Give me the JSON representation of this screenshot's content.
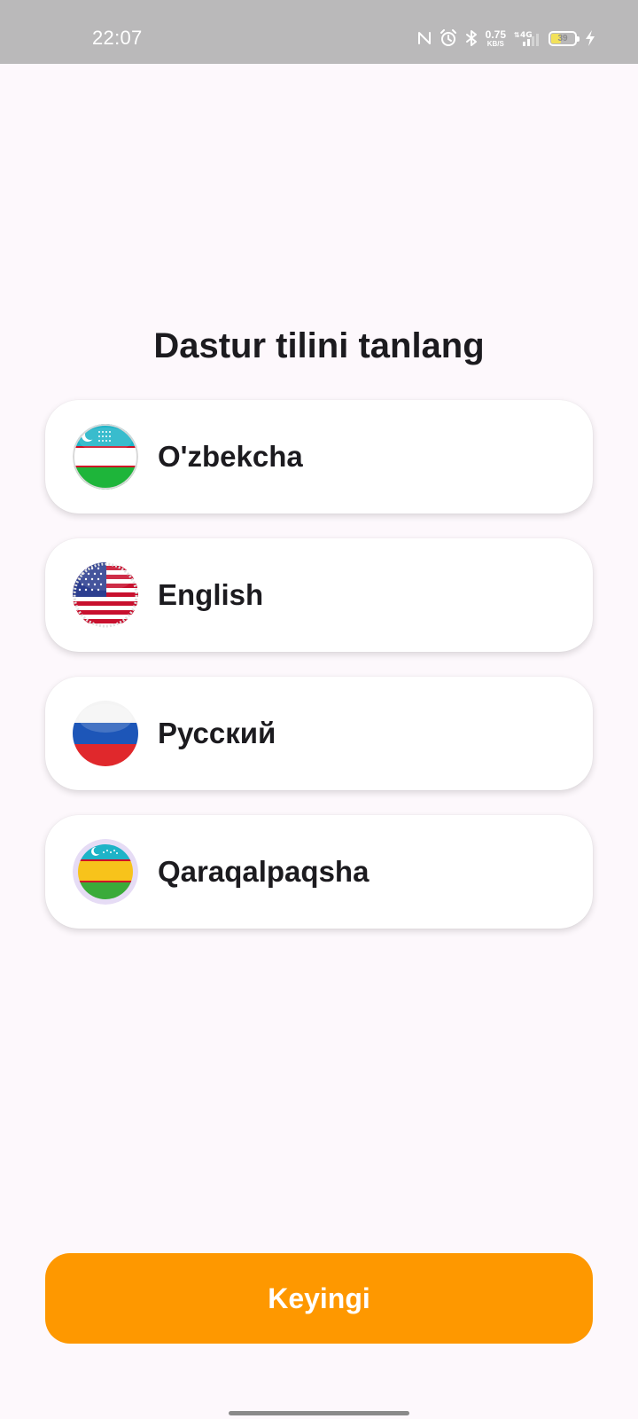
{
  "status_bar": {
    "time": "22:07",
    "net_speed_value": "0.75",
    "net_speed_unit": "KB/S",
    "network_label": "4G",
    "battery_level": "39",
    "battery_fill": 0.39,
    "icons": [
      "nfc-icon",
      "alarm-icon",
      "bluetooth-icon",
      "signal-icon",
      "battery-icon",
      "charging-icon"
    ]
  },
  "title": "Dastur tilini tanlang",
  "languages": [
    {
      "label": "O'zbekcha",
      "flag": "uzbekistan-flag-icon"
    },
    {
      "label": "English",
      "flag": "usa-flag-icon"
    },
    {
      "label": "Русский",
      "flag": "russia-flag-icon"
    },
    {
      "label": "Qaraqalpaqsha",
      "flag": "karakalpakstan-flag-icon"
    }
  ],
  "next_button": {
    "label": "Keyingi"
  },
  "colors": {
    "accent": "#fe9800",
    "background": "#fdf8fc",
    "status_bar": "#bab9ba",
    "card": "#ffffff",
    "text": "#1c1b1f"
  }
}
